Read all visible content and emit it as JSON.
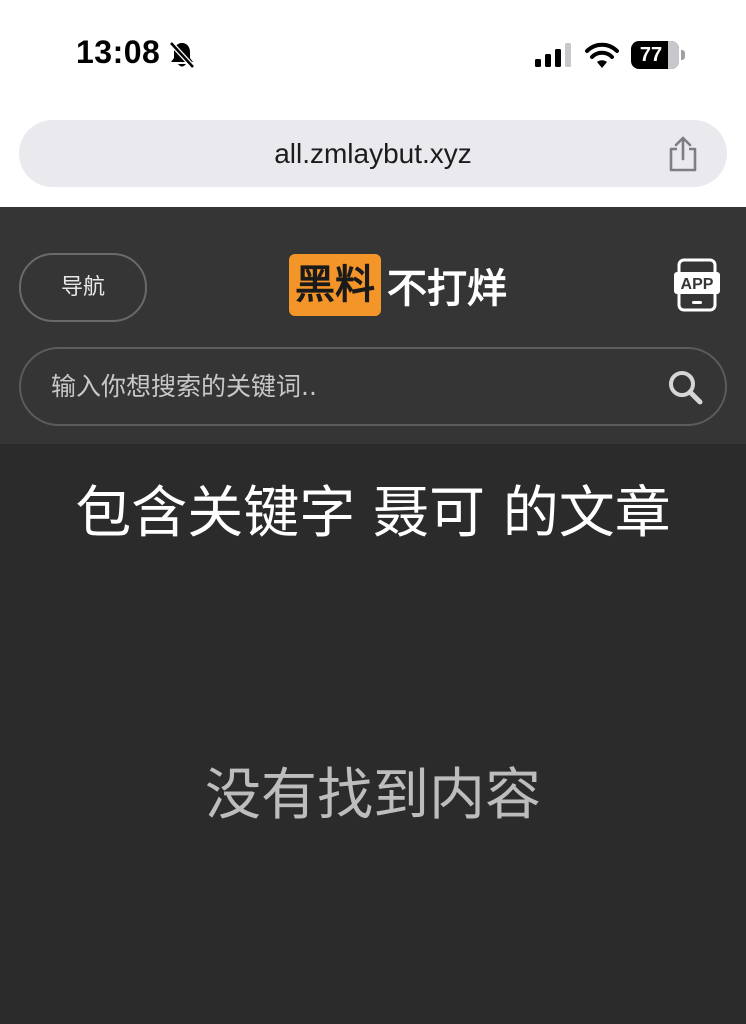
{
  "status_bar": {
    "time": "13:08",
    "battery_level": "77",
    "battery_fraction": 0.77,
    "icons": [
      "bell-slash-icon",
      "signal-icon",
      "wifi-icon",
      "battery-icon"
    ]
  },
  "browser": {
    "url": "all.zmlaybut.xyz",
    "share_icon": "share-icon"
  },
  "header": {
    "nav_label": "导航",
    "logo_badge": "黑料",
    "logo_rest": "不打烊",
    "app_icon_label": "APP",
    "search_placeholder": "输入你想搜索的关键词..",
    "search_value": "",
    "colors": {
      "header_bg": "#353536",
      "page_bg": "#2c2b2c",
      "logo_accent": "#f4952a"
    }
  },
  "content": {
    "heading": "包含关键字 聂可 的文章",
    "empty_message": "没有找到内容"
  }
}
